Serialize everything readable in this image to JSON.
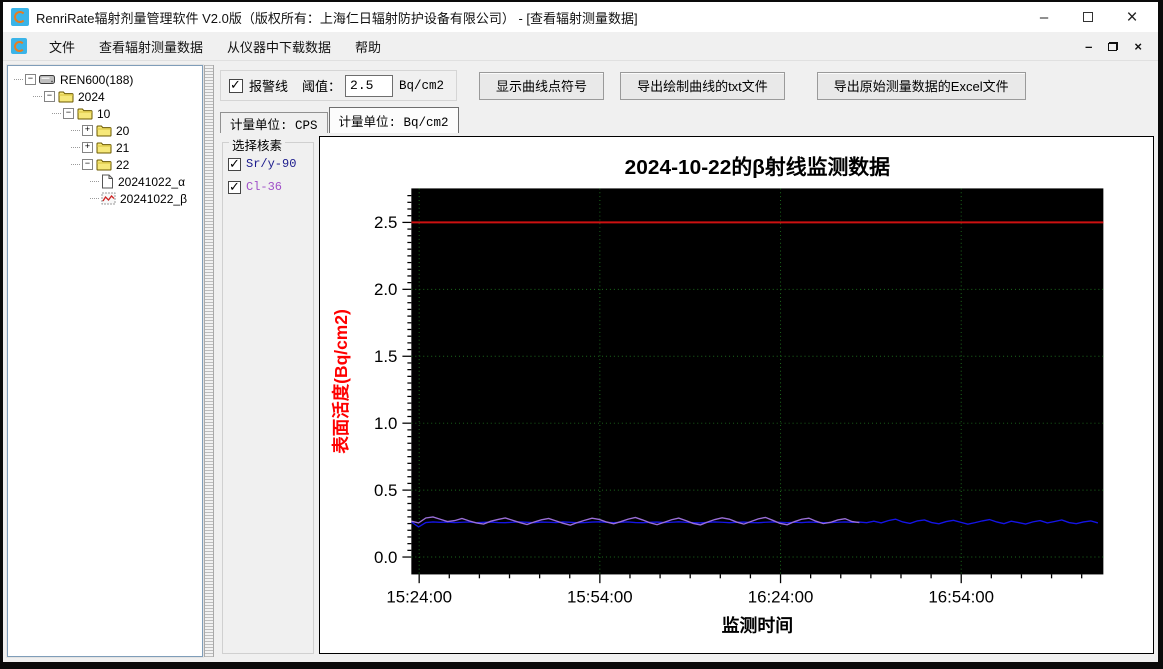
{
  "window": {
    "title": "RenriRate辐射剂量管理软件 V2.0版（版权所有：上海仁日辐射防护设备有限公司） - [查看辐射测量数据]",
    "icons": {
      "minimize": "–",
      "close": "×",
      "mdi_minimize": "–",
      "mdi_close": "×"
    }
  },
  "menu": {
    "items": [
      "文件",
      "查看辐射测量数据",
      "从仪器中下载数据",
      "帮助"
    ]
  },
  "tree": {
    "items": [
      {
        "label": "REN600(188)",
        "depth": 0,
        "icon": "device",
        "expander": "minus"
      },
      {
        "label": "2024",
        "depth": 1,
        "icon": "folder",
        "expander": "minus"
      },
      {
        "label": "10",
        "depth": 2,
        "icon": "folder",
        "expander": "minus"
      },
      {
        "label": "20",
        "depth": 3,
        "icon": "folder",
        "expander": "plus"
      },
      {
        "label": "21",
        "depth": 3,
        "icon": "folder",
        "expander": "plus"
      },
      {
        "label": "22",
        "depth": 3,
        "icon": "folder",
        "expander": "minus"
      },
      {
        "label": "20241022_α",
        "depth": 4,
        "icon": "doc",
        "expander": null
      },
      {
        "label": "20241022_β",
        "depth": 4,
        "icon": "chart",
        "expander": null
      }
    ]
  },
  "toolbar": {
    "alarm_checkbox_label": "报警线",
    "alarm_checked": true,
    "threshold_label": "阈值：",
    "threshold_value": "2.5",
    "threshold_unit": "Bq/cm2",
    "buttons": [
      {
        "label": "显示曲线点符号"
      },
      {
        "label": "导出绘制曲线的txt文件"
      },
      {
        "label": "导出原始测量数据的Excel文件"
      }
    ]
  },
  "tabs": [
    {
      "label": "计量单位: CPS",
      "active": false
    },
    {
      "label": "计量单位: Bq/cm2",
      "active": true
    }
  ],
  "nuclide_panel": {
    "title": "选择核素",
    "items": [
      {
        "label": "Sr/y-90",
        "checked": true,
        "color": "#1a1a8c"
      },
      {
        "label": "Cl-36",
        "checked": true,
        "color": "#a050c8"
      }
    ]
  },
  "chart_data": {
    "type": "line",
    "title": "2024-10-22的β射线监测数据",
    "xlabel": "监测时间",
    "ylabel": "表面活度(Bq/cm2)",
    "ylabel_color": "#ff0000",
    "plot_bg": "#000000",
    "grid": {
      "color": "#1d6b1d",
      "style": "dotted",
      "on": true
    },
    "ylim": [
      -0.13,
      2.754
    ],
    "y_ticks": [
      0.0,
      0.5,
      1.0,
      1.5,
      2.0,
      2.5
    ],
    "y_tick_labels": [
      "0.0",
      "0.5",
      "1.0",
      "1.5",
      "2.0",
      "2.5"
    ],
    "y_minor_step": 0.05,
    "xlim_minutes": [
      -1.3,
      113.6
    ],
    "x_origin_time": "15:24:00",
    "x_ticks": [
      {
        "minute": 0,
        "label": "15:24:00"
      },
      {
        "minute": 30,
        "label": "15:54:00"
      },
      {
        "minute": 60,
        "label": "16:24:00"
      },
      {
        "minute": 90,
        "label": "16:54:00"
      }
    ],
    "x_minor_step_minutes": 5,
    "alarm_line": {
      "value": 2.5,
      "color": "#cc1111"
    },
    "legend_position": "none",
    "series": [
      {
        "name": "Sr/y-90",
        "color": "#1414e6",
        "x_start_min": -1.3,
        "x_step_min": 1.2,
        "values": [
          0.262,
          0.225,
          0.258,
          0.262,
          0.259,
          0.261,
          0.258,
          0.26,
          0.262,
          0.257,
          0.259,
          0.261,
          0.258,
          0.256,
          0.26,
          0.262,
          0.259,
          0.257,
          0.261,
          0.26,
          0.258,
          0.262,
          0.259,
          0.256,
          0.258,
          0.261,
          0.263,
          0.259,
          0.257,
          0.26,
          0.262,
          0.258,
          0.256,
          0.259,
          0.261,
          0.258,
          0.26,
          0.263,
          0.259,
          0.257,
          0.255,
          0.259,
          0.262,
          0.26,
          0.257,
          0.259,
          0.261,
          0.258,
          0.256,
          0.26,
          0.262,
          0.259,
          0.257,
          0.26,
          0.258,
          0.261,
          0.259,
          0.256,
          0.258,
          0.26,
          0.262,
          0.259,
          0.261,
          0.257,
          0.268,
          0.255,
          0.272,
          0.283,
          0.262,
          0.251,
          0.27,
          0.277,
          0.258,
          0.248,
          0.265,
          0.274,
          0.26,
          0.245,
          0.257,
          0.27,
          0.28,
          0.262,
          0.25,
          0.268,
          0.258,
          0.247,
          0.263,
          0.272,
          0.255,
          0.266,
          0.277,
          0.258,
          0.249,
          0.262,
          0.27,
          0.255
        ]
      },
      {
        "name": "Cl-36",
        "color": "#9a6fd8",
        "x_start_min": -1.3,
        "x_step_min": 1.2,
        "values": [
          0.268,
          0.255,
          0.292,
          0.3,
          0.282,
          0.265,
          0.272,
          0.288,
          0.27,
          0.255,
          0.247,
          0.268,
          0.281,
          0.292,
          0.275,
          0.258,
          0.243,
          0.262,
          0.278,
          0.288,
          0.27,
          0.252,
          0.238,
          0.258,
          0.275,
          0.29,
          0.281,
          0.262,
          0.248,
          0.265,
          0.283,
          0.295,
          0.277,
          0.256,
          0.242,
          0.26,
          0.279,
          0.291,
          0.272,
          0.251,
          0.24,
          0.262,
          0.28,
          0.293,
          0.283,
          0.261,
          0.246,
          0.266,
          0.285,
          0.296,
          0.274,
          0.252,
          0.241,
          0.264,
          0.282,
          0.29,
          0.268,
          0.25,
          0.259,
          0.277,
          0.287,
          0.265,
          0.258
        ]
      }
    ]
  }
}
